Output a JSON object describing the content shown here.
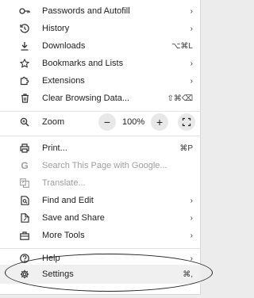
{
  "menu": {
    "items_top": [
      {
        "label": "Passwords and Autofill",
        "icon": "key-icon",
        "tail": "›"
      },
      {
        "label": "History",
        "icon": "history-icon",
        "tail": "›"
      },
      {
        "label": "Downloads",
        "icon": "download-icon",
        "tail": "⌥⌘L"
      },
      {
        "label": "Bookmarks and Lists",
        "icon": "star-icon",
        "tail": "›"
      },
      {
        "label": "Extensions",
        "icon": "puzzle-icon",
        "tail": "›"
      },
      {
        "label": "Clear Browsing Data...",
        "icon": "trash-icon",
        "tail": "⇧⌘⌫"
      }
    ],
    "zoom": {
      "label": "Zoom",
      "minus": "−",
      "value": "100%",
      "plus": "+"
    },
    "items_mid": [
      {
        "label": "Print...",
        "icon": "printer-icon",
        "tail": "⌘P",
        "disabled": false
      },
      {
        "label": "Search This Page with Google...",
        "icon": "google-icon",
        "tail": "",
        "disabled": true
      },
      {
        "label": "Translate...",
        "icon": "translate-icon",
        "tail": "",
        "disabled": true
      },
      {
        "label": "Find and Edit",
        "icon": "find-icon",
        "tail": "›",
        "disabled": false
      },
      {
        "label": "Save and Share",
        "icon": "save-share-icon",
        "tail": "›",
        "disabled": false
      },
      {
        "label": "More Tools",
        "icon": "toolbox-icon",
        "tail": "›",
        "disabled": false
      }
    ],
    "help": {
      "label": "Help",
      "tail": "›"
    },
    "settings": {
      "label": "Settings",
      "tail": "⌘,"
    }
  }
}
